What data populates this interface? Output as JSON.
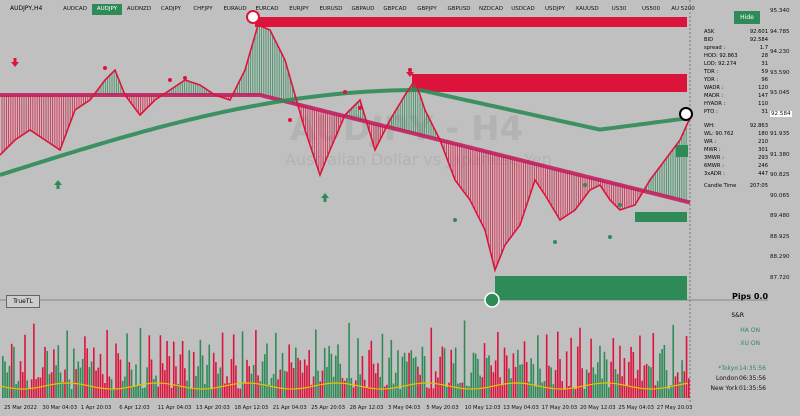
{
  "window": {
    "title": "AUDJPY,H4"
  },
  "symbols": [
    "AUDCAD",
    "AUDJPY",
    "AUDNZD",
    "CADJPY",
    "CHFJPY",
    "EURAUD",
    "EURCAD",
    "EURJPY",
    "EURUSD",
    "GBPAUD",
    "GBPCAD",
    "GBPJPY",
    "GBPUSD",
    "NZDCAD",
    "USDCAD",
    "USDJPY",
    "XAUUSD",
    "US30",
    "US500",
    "AU 5200"
  ],
  "active_symbol": "AUDJPY",
  "hide_button": "Hide",
  "info": [
    {
      "k": "ASK",
      "v": "92.601"
    },
    {
      "k": "BID",
      "v": "92.584"
    },
    {
      "k": "spread :",
      "v": "1.7"
    },
    {
      "k": "HOD: 92.863",
      "v": "28"
    },
    {
      "k": "LOD: 92.274",
      "v": "31"
    },
    {
      "k": "TDR :",
      "v": "59"
    },
    {
      "k": "YDR :",
      "v": "96"
    },
    {
      "k": "WADR :",
      "v": "120"
    },
    {
      "k": "MADR :",
      "v": "147"
    },
    {
      "k": "HYADR :",
      "v": "110"
    },
    {
      "k": "PTO :",
      "v": "31"
    },
    {
      "k": "WH:",
      "v": "92.863"
    },
    {
      "k": "WL: 90.762",
      "v": "180"
    },
    {
      "k": "WR :",
      "v": "210"
    },
    {
      "k": "MWR :",
      "v": "301"
    },
    {
      "k": "3MWR :",
      "v": "293"
    },
    {
      "k": "6MWR :",
      "v": "246"
    },
    {
      "k": "3xADR :",
      "v": "447"
    },
    {
      "k": "Candle Time",
      "v": "207:05"
    }
  ],
  "price_labels": [
    "95.340",
    "94.785",
    "94.230",
    "93.590",
    "93.045",
    "92.584",
    "91.935",
    "91.380",
    "90.825",
    "90.065",
    "89.480",
    "88.925",
    "88.290",
    "87.720"
  ],
  "watermark": {
    "symbol": "AUDJPY - H4",
    "name": "Australian Dollar vs Japanese Yen"
  },
  "pips": "Pips 0.0",
  "truetl": "TrueTL",
  "sr_panel": {
    "title": "S&R",
    "ha": "HA ON",
    "xu": "XU ON"
  },
  "sessions": [
    {
      "name": "*Tokyo",
      "time": "14:35:56",
      "color": "#2e8b57"
    },
    {
      "name": "London",
      "time": "06:35:56",
      "color": "#111"
    },
    {
      "name": "New York",
      "time": "01:35:56",
      "color": "#111"
    }
  ],
  "x_labels": [
    "25 Mar 2022",
    "30 Mar 04:03",
    "1 Apr 20:03",
    "6 Apr 12:03",
    "11 Apr 04:03",
    "13 Apr 20:03",
    "18 Apr 12:03",
    "21 Apr 04:03",
    "25 Apr 20:03",
    "28 Apr 12:03",
    "3 May 04:03",
    "5 May 20:03",
    "10 May 12:03",
    "13 May 04:03",
    "17 May 20:03",
    "20 May 12:03",
    "25 May 04:03",
    "27 May 20:03"
  ],
  "colors": {
    "bull": "#2e8b57",
    "bear": "#dc143c",
    "ma": "#c2185b",
    "bg": "#c0c0c0"
  }
}
